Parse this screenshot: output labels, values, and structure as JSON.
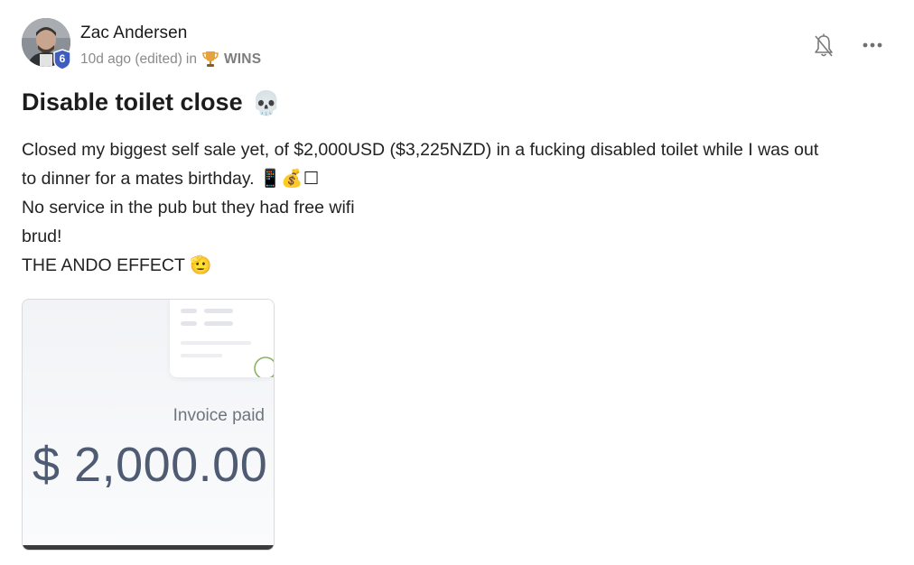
{
  "post": {
    "author": "Zac Andersen",
    "level": "6",
    "time": "10d ago (edited)",
    "in_label": "in",
    "category": "WINS",
    "title": "Disable toilet close",
    "title_emoji": "💀",
    "body_lines": [
      "Closed my biggest self sale yet, of $2,000USD ($3,225NZD) in a fucking disabled toilet while I was out",
      "to dinner for a mates birthday. 📱💰☐",
      "No service in the pub but they had free wifi",
      "brud!",
      "THE ANDO EFFECT 🫡"
    ]
  },
  "attachment": {
    "status": "Invoice paid",
    "amount": "$ 2,000.00"
  },
  "icons": {
    "avatar": "avatar",
    "level_badge": "shield-badge-icon",
    "category": "trophy-icon",
    "notify": "bell-off-icon",
    "more": "more-horizontal-icon"
  },
  "colors": {
    "badge": "#3f5dbf",
    "meta_text": "#8a8a8a",
    "amount_text": "#4f5b73"
  }
}
